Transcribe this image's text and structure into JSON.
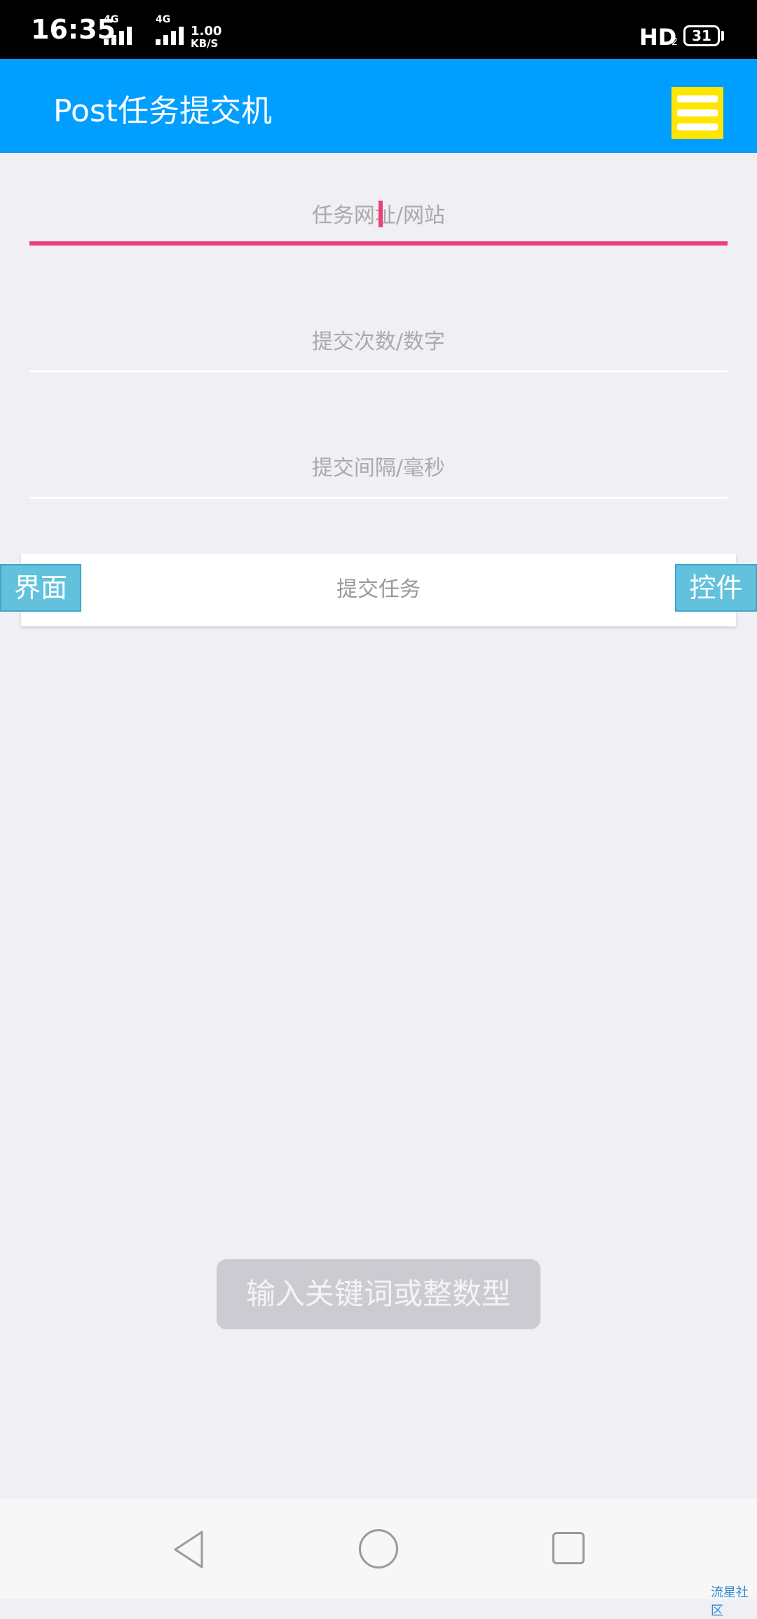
{
  "status_bar": {
    "time": "16:35",
    "network_1": "4G",
    "network_2": "4G",
    "speed_value": "1.00",
    "speed_unit": "KB/S",
    "hd_label": "HD",
    "hd_sub": "2",
    "battery": "31"
  },
  "app_bar": {
    "title": "Post任务提交机",
    "menu_icon": "menu-icon",
    "menu_color": "#ffe600",
    "bar_color": "#009eff"
  },
  "form": {
    "url_placeholder": "任务网址/网站",
    "count_placeholder": "提交次数/数字",
    "interval_placeholder": "提交间隔/毫秒",
    "submit_label": "提交任务",
    "accent_color": "#e94078"
  },
  "side_tabs": {
    "left": "界面",
    "right": "控件"
  },
  "toast": {
    "text": "输入关键词或整数型"
  },
  "nav_bar": {
    "back_icon": "back-icon",
    "home_icon": "home-icon",
    "recent_icon": "recent-apps-icon"
  },
  "watermark": "流星社区"
}
